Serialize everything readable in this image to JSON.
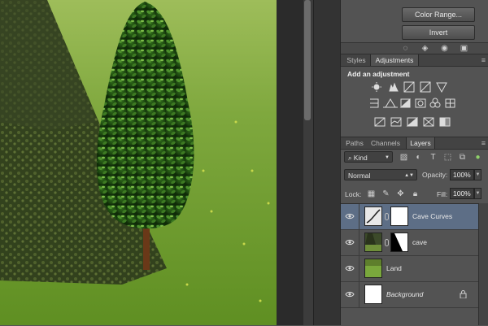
{
  "mask_panel": {
    "color_range_label": "Color Range...",
    "invert_label": "Invert"
  },
  "adjustments_panel": {
    "tabs": [
      "Styles",
      "Adjustments"
    ],
    "active_tab": "Adjustments",
    "heading": "Add an adjustment",
    "row1_icons": [
      "brightness-contrast-icon",
      "levels-icon",
      "curves-icon",
      "exposure-icon",
      "vibrance-icon"
    ],
    "row2_icons": [
      "hue-saturation-icon",
      "color-balance-icon",
      "black-white-icon",
      "photo-filter-icon",
      "channel-mixer-icon",
      "color-lookup-icon"
    ],
    "row3_icons": [
      "invert-icon",
      "posterize-icon",
      "threshold-icon",
      "selective-color-icon",
      "gradient-map-icon"
    ]
  },
  "layers_panel": {
    "tabs": [
      "Paths",
      "Channels",
      "Layers"
    ],
    "active_tab": "Layers",
    "filter_label": "Kind",
    "blend_mode": "Normal",
    "opacity_label": "Opacity:",
    "opacity_value": "100%",
    "lock_label": "Lock:",
    "fill_label": "Fill:",
    "fill_value": "100%",
    "layers": [
      {
        "name": "Cave Curves",
        "selected": true,
        "italic": false
      },
      {
        "name": "cave",
        "selected": false,
        "italic": false
      },
      {
        "name": "Land",
        "selected": false,
        "italic": false
      },
      {
        "name": "Background",
        "selected": false,
        "italic": true
      }
    ]
  },
  "colors": {
    "selected_row": "#5d6e86",
    "panel_bg": "#535353",
    "grass": "#7ca43c"
  }
}
